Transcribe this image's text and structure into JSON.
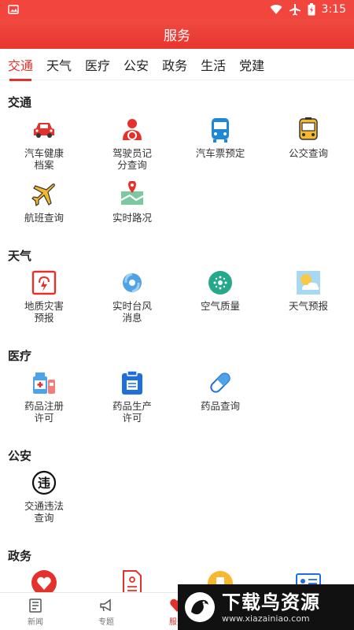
{
  "status": {
    "time": "3:15",
    "icons": [
      "image-icon",
      "wifi-icon",
      "airplane-icon",
      "battery-icon"
    ]
  },
  "header": {
    "title": "服务"
  },
  "tabs": [
    {
      "label": "交通",
      "active": true
    },
    {
      "label": "天气"
    },
    {
      "label": "医疗"
    },
    {
      "label": "公安"
    },
    {
      "label": "政务"
    },
    {
      "label": "生活"
    },
    {
      "label": "党建"
    }
  ],
  "sections": {
    "traffic": {
      "title": "交通",
      "items": [
        {
          "label_l1": "汽车健康",
          "label_l2": "档案",
          "icon": "car-icon"
        },
        {
          "label_l1": "驾驶员记",
          "label_l2": "分查询",
          "icon": "driver-icon"
        },
        {
          "label_l1": "汽车票预定",
          "label_l2": "",
          "icon": "bus-icon"
        },
        {
          "label_l1": "公交查询",
          "label_l2": "",
          "icon": "bus-card-icon"
        },
        {
          "label_l1": "航班查询",
          "label_l2": "",
          "icon": "airplane-icon"
        },
        {
          "label_l1": "实时路况",
          "label_l2": "",
          "icon": "map-pin-icon"
        }
      ]
    },
    "weather": {
      "title": "天气",
      "items": [
        {
          "label_l1": "地质灾害",
          "label_l2": "预报",
          "icon": "disaster-icon"
        },
        {
          "label_l1": "实时台风",
          "label_l2": "消息",
          "icon": "typhoon-icon"
        },
        {
          "label_l1": "空气质量",
          "label_l2": "",
          "icon": "air-quality-icon"
        },
        {
          "label_l1": "天气预报",
          "label_l2": "",
          "icon": "weather-icon"
        }
      ]
    },
    "medical": {
      "title": "医疗",
      "items": [
        {
          "label_l1": "药品注册",
          "label_l2": "许可",
          "icon": "medicine-register-icon"
        },
        {
          "label_l1": "药品生产",
          "label_l2": "许可",
          "icon": "medicine-production-icon"
        },
        {
          "label_l1": "药品查询",
          "label_l2": "",
          "icon": "pill-icon"
        }
      ]
    },
    "police": {
      "title": "公安",
      "items": [
        {
          "label_l1": "交通违法",
          "label_l2": "查询",
          "icon": "violation-icon"
        }
      ]
    },
    "gov": {
      "title": "政务",
      "items": [
        {
          "icon": "heart-icon"
        },
        {
          "icon": "document-icon"
        },
        {
          "icon": "badge-icon"
        },
        {
          "icon": "id-card-icon"
        }
      ]
    }
  },
  "bottom_nav": [
    {
      "label": "新闻",
      "icon": "news-icon"
    },
    {
      "label": "专题",
      "icon": "megaphone-icon"
    },
    {
      "label": "服务",
      "icon": "service-icon",
      "active": true
    }
  ],
  "watermark": {
    "title": "下载鸟资源",
    "url": "www.xiazainiao.com"
  },
  "colors": {
    "accent": "#e3322c",
    "header": "#ef4a41"
  }
}
